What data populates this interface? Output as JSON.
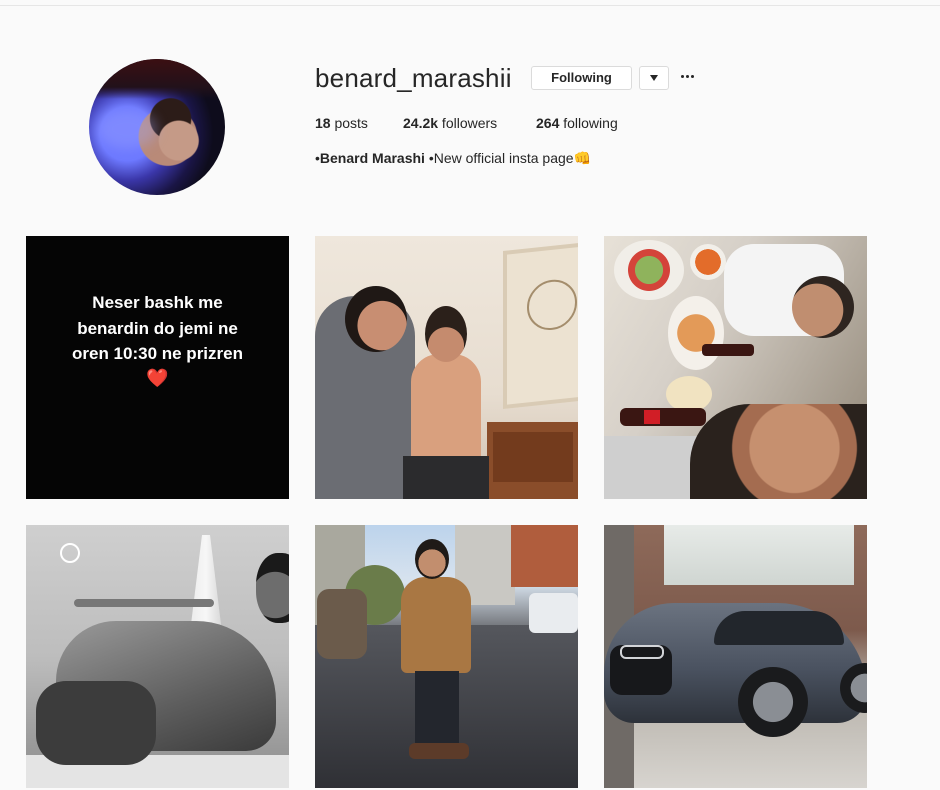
{
  "profile": {
    "username": "benard_marashii",
    "follow_button": "Following",
    "stats": {
      "posts_count": "18",
      "posts_label": " posts",
      "followers_count": "24.2k",
      "followers_label": " followers",
      "following_count": "264",
      "following_label": " following"
    },
    "bio": {
      "prefix": "•",
      "name": "Benard Marashi",
      "text": " •New official insta page",
      "emoji": "👊"
    }
  },
  "posts": [
    {
      "caption_lines": [
        "Neser bashk me",
        "benardin do jemi ne",
        "oren 10:30 ne prizren"
      ],
      "emoji": "❤️"
    },
    {},
    {},
    {},
    {},
    {}
  ],
  "colors": {
    "background": "#fafafa",
    "text": "#262626",
    "border": "#dbdbdb",
    "heart": "#e0283f"
  },
  "icons": {
    "dropdown": "chevron-down-icon",
    "more": "more-horizontal-icon"
  }
}
